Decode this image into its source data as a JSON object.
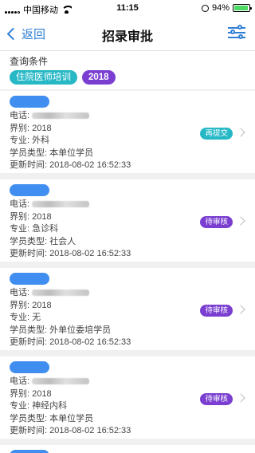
{
  "status_bar": {
    "carrier": "中国移动",
    "time": "11:15",
    "battery": "94%",
    "battery_level": 0.94
  },
  "nav": {
    "back_label": "返回",
    "title": "招录审批"
  },
  "query": {
    "label": "查询条件",
    "chips": [
      "住院医师培训",
      "2018"
    ]
  },
  "field_labels": {
    "phone": "电话:",
    "session": "界别:",
    "major": "专业:",
    "type": "学员类型:",
    "updated": "更新时间:"
  },
  "records": [
    {
      "session": "2018",
      "major": "外科",
      "type": "本单位学员",
      "updated": "2018-08-02 16:52:33",
      "status": "再提交"
    },
    {
      "session": "2018",
      "major": "急诊科",
      "type": "社会人",
      "updated": "2018-08-02 16:52:33",
      "status": "待审核"
    },
    {
      "session": "2018",
      "major": "无",
      "type": "外单位委培学员",
      "updated": "2018-08-02 16:52:33",
      "status": "待审核"
    },
    {
      "session": "2018",
      "major": "神经内科",
      "type": "本单位学员",
      "updated": "2018-08-02 16:52:33",
      "status": "待审核"
    }
  ],
  "colors": {
    "accent": "#2f7fd6",
    "teal": "#27b8c6",
    "purple": "#7a3fd0",
    "name_pill": "#3f8ef0"
  }
}
